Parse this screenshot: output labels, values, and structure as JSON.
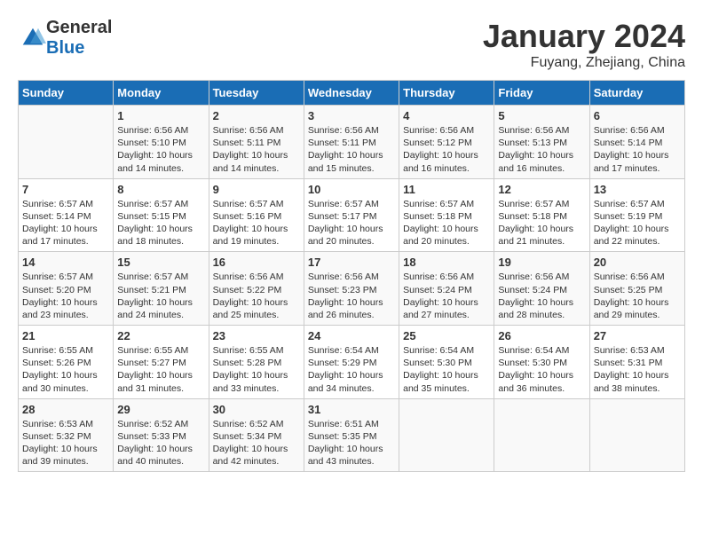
{
  "header": {
    "logo": {
      "general": "General",
      "blue": "Blue"
    },
    "month": "January 2024",
    "location": "Fuyang, Zhejiang, China"
  },
  "weekdays": [
    "Sunday",
    "Monday",
    "Tuesday",
    "Wednesday",
    "Thursday",
    "Friday",
    "Saturday"
  ],
  "weeks": [
    [
      {
        "day": "",
        "info": ""
      },
      {
        "day": "1",
        "info": "Sunrise: 6:56 AM\nSunset: 5:10 PM\nDaylight: 10 hours\nand 14 minutes."
      },
      {
        "day": "2",
        "info": "Sunrise: 6:56 AM\nSunset: 5:11 PM\nDaylight: 10 hours\nand 14 minutes."
      },
      {
        "day": "3",
        "info": "Sunrise: 6:56 AM\nSunset: 5:11 PM\nDaylight: 10 hours\nand 15 minutes."
      },
      {
        "day": "4",
        "info": "Sunrise: 6:56 AM\nSunset: 5:12 PM\nDaylight: 10 hours\nand 16 minutes."
      },
      {
        "day": "5",
        "info": "Sunrise: 6:56 AM\nSunset: 5:13 PM\nDaylight: 10 hours\nand 16 minutes."
      },
      {
        "day": "6",
        "info": "Sunrise: 6:56 AM\nSunset: 5:14 PM\nDaylight: 10 hours\nand 17 minutes."
      }
    ],
    [
      {
        "day": "7",
        "info": "Sunrise: 6:57 AM\nSunset: 5:14 PM\nDaylight: 10 hours\nand 17 minutes."
      },
      {
        "day": "8",
        "info": "Sunrise: 6:57 AM\nSunset: 5:15 PM\nDaylight: 10 hours\nand 18 minutes."
      },
      {
        "day": "9",
        "info": "Sunrise: 6:57 AM\nSunset: 5:16 PM\nDaylight: 10 hours\nand 19 minutes."
      },
      {
        "day": "10",
        "info": "Sunrise: 6:57 AM\nSunset: 5:17 PM\nDaylight: 10 hours\nand 20 minutes."
      },
      {
        "day": "11",
        "info": "Sunrise: 6:57 AM\nSunset: 5:18 PM\nDaylight: 10 hours\nand 20 minutes."
      },
      {
        "day": "12",
        "info": "Sunrise: 6:57 AM\nSunset: 5:18 PM\nDaylight: 10 hours\nand 21 minutes."
      },
      {
        "day": "13",
        "info": "Sunrise: 6:57 AM\nSunset: 5:19 PM\nDaylight: 10 hours\nand 22 minutes."
      }
    ],
    [
      {
        "day": "14",
        "info": "Sunrise: 6:57 AM\nSunset: 5:20 PM\nDaylight: 10 hours\nand 23 minutes."
      },
      {
        "day": "15",
        "info": "Sunrise: 6:57 AM\nSunset: 5:21 PM\nDaylight: 10 hours\nand 24 minutes."
      },
      {
        "day": "16",
        "info": "Sunrise: 6:56 AM\nSunset: 5:22 PM\nDaylight: 10 hours\nand 25 minutes."
      },
      {
        "day": "17",
        "info": "Sunrise: 6:56 AM\nSunset: 5:23 PM\nDaylight: 10 hours\nand 26 minutes."
      },
      {
        "day": "18",
        "info": "Sunrise: 6:56 AM\nSunset: 5:24 PM\nDaylight: 10 hours\nand 27 minutes."
      },
      {
        "day": "19",
        "info": "Sunrise: 6:56 AM\nSunset: 5:24 PM\nDaylight: 10 hours\nand 28 minutes."
      },
      {
        "day": "20",
        "info": "Sunrise: 6:56 AM\nSunset: 5:25 PM\nDaylight: 10 hours\nand 29 minutes."
      }
    ],
    [
      {
        "day": "21",
        "info": "Sunrise: 6:55 AM\nSunset: 5:26 PM\nDaylight: 10 hours\nand 30 minutes."
      },
      {
        "day": "22",
        "info": "Sunrise: 6:55 AM\nSunset: 5:27 PM\nDaylight: 10 hours\nand 31 minutes."
      },
      {
        "day": "23",
        "info": "Sunrise: 6:55 AM\nSunset: 5:28 PM\nDaylight: 10 hours\nand 33 minutes."
      },
      {
        "day": "24",
        "info": "Sunrise: 6:54 AM\nSunset: 5:29 PM\nDaylight: 10 hours\nand 34 minutes."
      },
      {
        "day": "25",
        "info": "Sunrise: 6:54 AM\nSunset: 5:30 PM\nDaylight: 10 hours\nand 35 minutes."
      },
      {
        "day": "26",
        "info": "Sunrise: 6:54 AM\nSunset: 5:30 PM\nDaylight: 10 hours\nand 36 minutes."
      },
      {
        "day": "27",
        "info": "Sunrise: 6:53 AM\nSunset: 5:31 PM\nDaylight: 10 hours\nand 38 minutes."
      }
    ],
    [
      {
        "day": "28",
        "info": "Sunrise: 6:53 AM\nSunset: 5:32 PM\nDaylight: 10 hours\nand 39 minutes."
      },
      {
        "day": "29",
        "info": "Sunrise: 6:52 AM\nSunset: 5:33 PM\nDaylight: 10 hours\nand 40 minutes."
      },
      {
        "day": "30",
        "info": "Sunrise: 6:52 AM\nSunset: 5:34 PM\nDaylight: 10 hours\nand 42 minutes."
      },
      {
        "day": "31",
        "info": "Sunrise: 6:51 AM\nSunset: 5:35 PM\nDaylight: 10 hours\nand 43 minutes."
      },
      {
        "day": "",
        "info": ""
      },
      {
        "day": "",
        "info": ""
      },
      {
        "day": "",
        "info": ""
      }
    ]
  ]
}
